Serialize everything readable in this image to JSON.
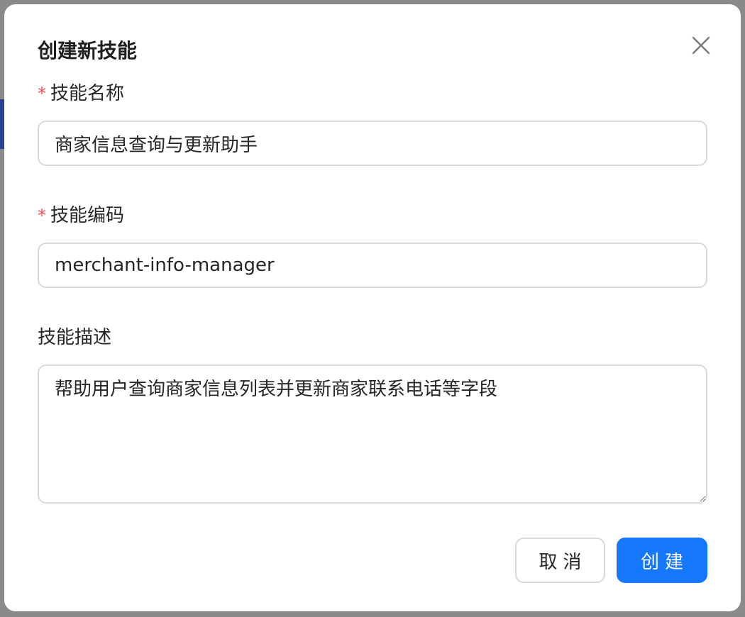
{
  "dialog": {
    "title": "创建新技能",
    "close_icon": "close-icon"
  },
  "form": {
    "name": {
      "label": "技能名称",
      "required_mark": "*",
      "value": "商家信息查询与更新助手"
    },
    "code": {
      "label": "技能编码",
      "required_mark": "*",
      "value": "merchant-info-manager"
    },
    "description": {
      "label": "技能描述",
      "value": "帮助用户查询商家信息列表并更新商家联系电话等字段"
    }
  },
  "actions": {
    "cancel_label": "取消",
    "create_label": "创建"
  },
  "colors": {
    "primary": "#1677ff",
    "required": "#ff4d4f",
    "border": "#d9d9d9"
  }
}
